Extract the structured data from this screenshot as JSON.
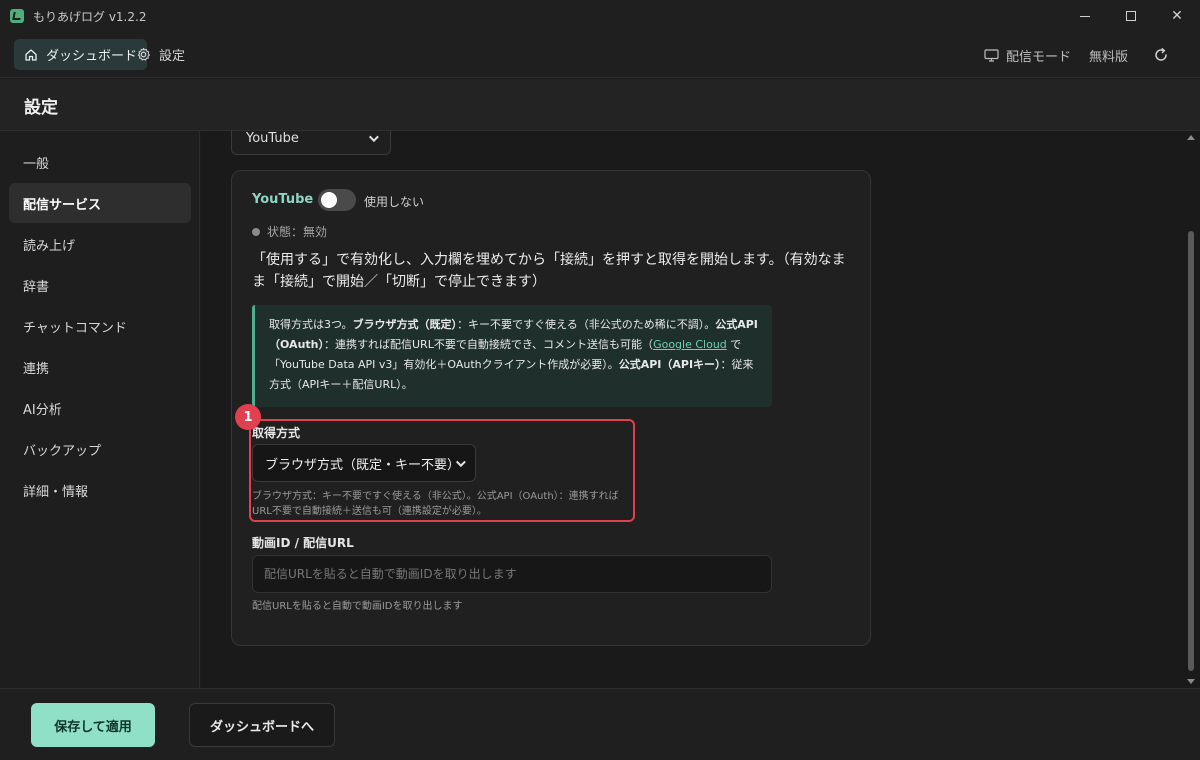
{
  "window": {
    "title": "もりあげログ  v1.2.2",
    "minimize_glyph": "minimize",
    "maximize_glyph": "maximize",
    "close_glyph": "✕"
  },
  "topnav": {
    "dashboard_label": "ダッシュボード",
    "settings_label": "設定",
    "stream_mode_label": "配信モード",
    "plan_label": "無料版"
  },
  "page": {
    "title": "設定"
  },
  "sidebar": {
    "items": [
      {
        "label": "一般"
      },
      {
        "label": "配信サービス"
      },
      {
        "label": "読み上げ"
      },
      {
        "label": "辞書"
      },
      {
        "label": "チャットコマンド"
      },
      {
        "label": "連携"
      },
      {
        "label": "AI分析"
      },
      {
        "label": "バックアップ"
      },
      {
        "label": "詳細・情報"
      }
    ],
    "active_index": 1
  },
  "service": {
    "selected": "YouTube",
    "card": {
      "name": "YouTube",
      "toggle_label": "使用しない",
      "toggle_on": false,
      "status": "状態：無効",
      "description": "「使用する」で有効化し、入力欄を埋めてから「接続」を押すと取得を開始します。（有効なまま「接続」で開始／「切断」で停止できます）",
      "info": {
        "part1": "取得方式は3つ。",
        "b1": "ブラウザ方式（既定）",
        "part2": "：キー不要ですぐ使える（非公式のため稀に不調）。",
        "b2": "公式API（OAuth）",
        "part3": "：連携すれば配信URL不要で自動接続でき、コメント送信も可能（",
        "link": "Google Cloud",
        "part4": " で「YouTube Data API v3」有効化＋OAuthクライアント作成が必要）。",
        "b3": "公式API（APIキー）",
        "part5": "：従来方式（APIキー＋配信URL）。"
      },
      "badge": "1",
      "method_label": "取得方式",
      "method_value": "ブラウザ方式（既定・キー不要）",
      "method_hint": "ブラウザ方式：キー不要ですぐ使える（非公式）。公式API（OAuth）：連携すればURL不要で自動接続＋送信も可（連携設定が必要）。",
      "url_label": "動画ID / 配信URL",
      "url_placeholder": "配信URLを貼ると自動で動画IDを取り出します",
      "url_value": "",
      "url_hint": "配信URLを貼ると自動で動画IDを取り出します"
    }
  },
  "footer": {
    "save_label": "保存して適用",
    "dashboard_label": "ダッシュボードへ"
  },
  "colors": {
    "accent": "#8fe0c6",
    "service_name": "#8fd3c2",
    "highlight": "#e0404f",
    "info_bg": "#1f302c"
  }
}
